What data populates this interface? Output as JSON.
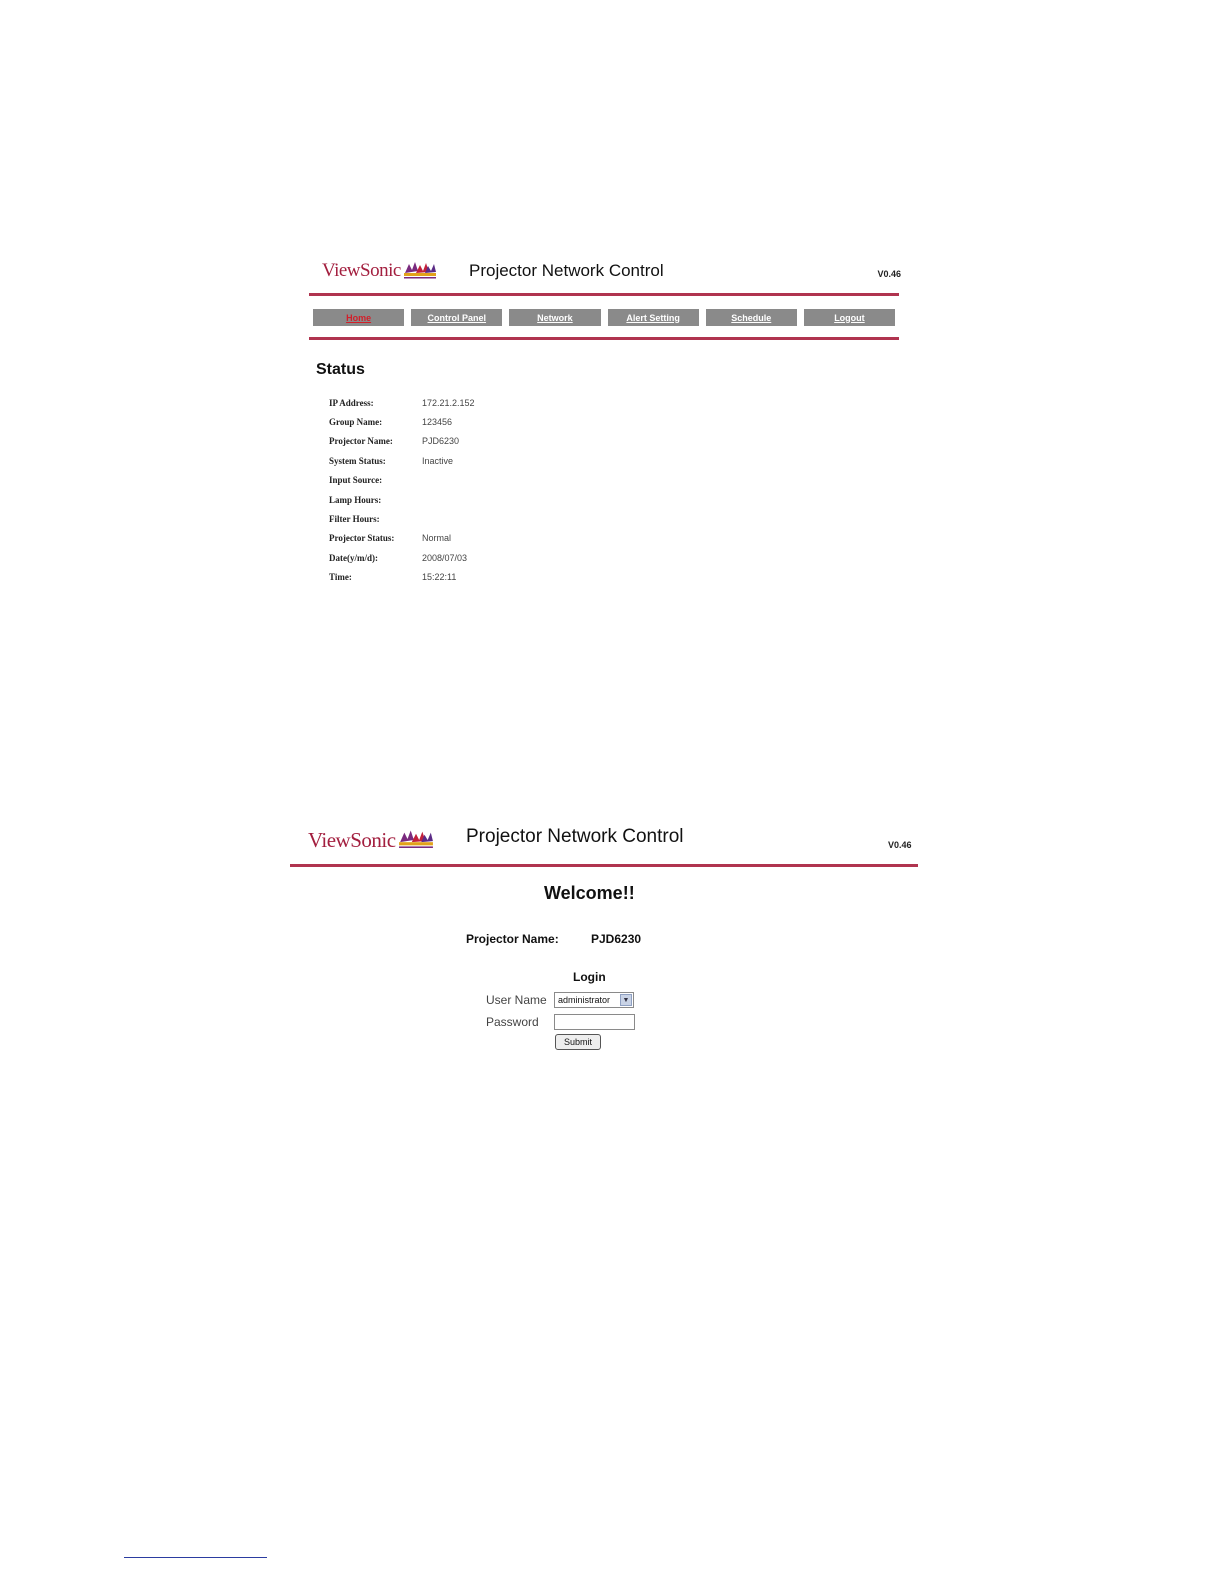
{
  "status_screen": {
    "logo": "ViewSonic",
    "title": "Projector Network Control",
    "version": "V0.46",
    "nav": [
      "Home",
      "Control Panel",
      "Network",
      "Alert Setting",
      "Schedule",
      "Logout"
    ],
    "active_nav": "Home",
    "heading": "Status",
    "rows": [
      {
        "label": "IP Address:",
        "value": "172.21.2.152"
      },
      {
        "label": "Group Name:",
        "value": "123456"
      },
      {
        "label": "Projector Name:",
        "value": "PJD6230"
      },
      {
        "label": "System Status:",
        "value": "Inactive"
      },
      {
        "label": "Input Source:",
        "value": ""
      },
      {
        "label": "Lamp Hours:",
        "value": ""
      },
      {
        "label": "Filter Hours:",
        "value": ""
      },
      {
        "label": "Projector Status:",
        "value": "Normal"
      },
      {
        "label": "Date(y/m/d):",
        "value": "2008/07/03"
      },
      {
        "label": "Time:",
        "value": "15:22:11"
      }
    ]
  },
  "login_screen": {
    "logo": "ViewSonic",
    "title": "Projector Network Control",
    "version": "V0.46",
    "welcome": "Welcome!!",
    "projector_name_label": "Projector Name:",
    "projector_name_value": "PJD6230",
    "login_title": "Login",
    "user_name_label": "User Name",
    "user_name_selected": "administrator",
    "password_label": "Password",
    "password_value": "",
    "submit_label": "Submit"
  },
  "colors": {
    "brand": "#a31f3f",
    "nav_bg": "#8a8a8a",
    "active_nav_text": "#d21f2a"
  },
  "icons": [
    "viewsonic-birds-logo-icon",
    "dropdown-arrow-icon"
  ]
}
